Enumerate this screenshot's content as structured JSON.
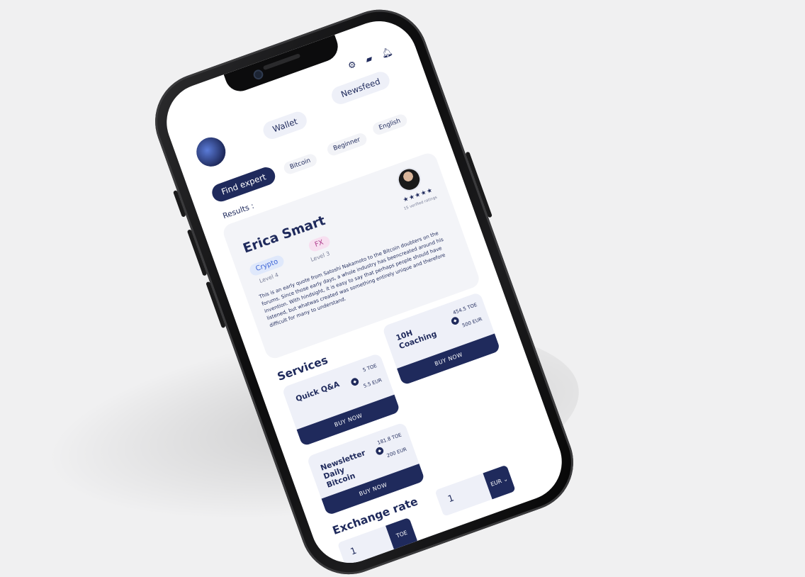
{
  "nav": {
    "wallet": "Wallet",
    "newsfeed": "Newsfeed",
    "find_expert": "Find expert"
  },
  "filters": {
    "topic": "Bitcoin",
    "level": "Beginner",
    "language": "English"
  },
  "results_label": "Results :",
  "expert": {
    "name": "Erica Smart",
    "tags": [
      {
        "label": "Crypto",
        "level": "Level 4"
      },
      {
        "label": "FX",
        "level": "Level 3"
      }
    ],
    "stars": "★★★★★",
    "verified": "15 verified ratings",
    "description": "This is an early quote from Satoshi Nakamoto to the Bitcoin doubters on the forums. Since those early days, a whole industry has beencreated around his invention. With hindsight, it is easy to say that perhaps people should have listened, but whatwas created was something entirely unique and therefore difficult for many to understand."
  },
  "services_title": "Services",
  "services": [
    {
      "name": "Quick Q&A",
      "toe": "5",
      "toe_unit": "TOE",
      "eur": "5.5",
      "eur_unit": "EUR",
      "buy": "BUY NOW"
    },
    {
      "name": "10H Coaching",
      "toe": "454.5",
      "toe_unit": "TOE",
      "eur": "500",
      "eur_unit": "EUR",
      "buy": "BUY NOW"
    },
    {
      "name": "Newsletter Daily Bitcoin",
      "toe": "181.8",
      "toe_unit": "TOE",
      "eur": "200",
      "eur_unit": "EUR",
      "buy": "BUY NOW"
    }
  ],
  "exchange": {
    "title": "Exchange rate",
    "left_value": "1",
    "left_unit": "TOE",
    "right_value": "1",
    "right_unit": "EUR ⌄"
  },
  "colors": {
    "navy": "#1f2a5c",
    "crypto": "#3b63d6",
    "fx": "#b0408f"
  },
  "icons": [
    "gear-icon",
    "chat-icon",
    "bell-icon",
    "coin-icon"
  ]
}
